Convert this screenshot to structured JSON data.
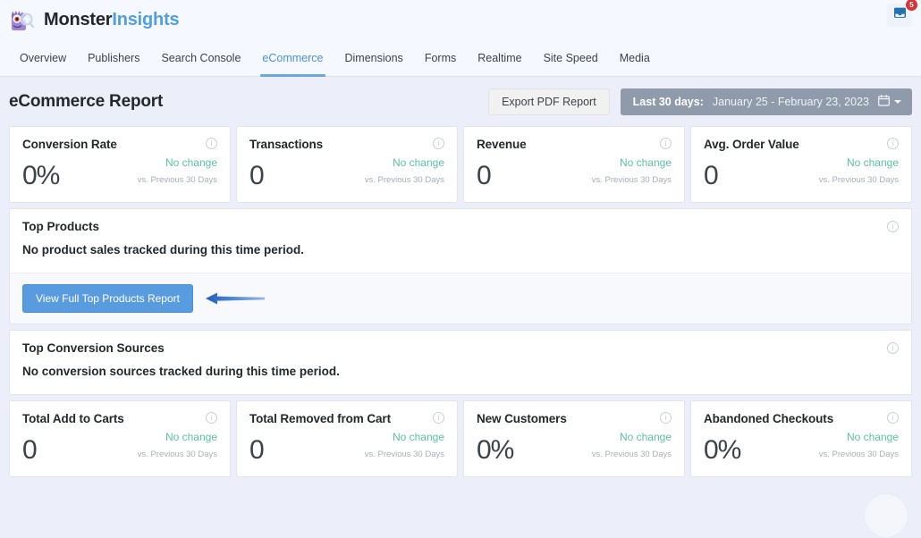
{
  "topbar": {
    "brand_first": "Monster",
    "brand_second": "Insights",
    "logo_icon": "monster-mascot-icon",
    "inbox_icon": "inbox-icon",
    "inbox_badge": "5"
  },
  "nav": {
    "tabs": [
      {
        "label": "Overview",
        "active": false
      },
      {
        "label": "Publishers",
        "active": false
      },
      {
        "label": "Search Console",
        "active": false
      },
      {
        "label": "eCommerce",
        "active": true
      },
      {
        "label": "Dimensions",
        "active": false
      },
      {
        "label": "Forms",
        "active": false
      },
      {
        "label": "Realtime",
        "active": false
      },
      {
        "label": "Site Speed",
        "active": false
      },
      {
        "label": "Media",
        "active": false
      }
    ]
  },
  "header": {
    "title": "eCommerce Report",
    "export_label": "Export PDF Report",
    "daterange_label": "Last 30 days:",
    "daterange_value": "January 25 - February 23, 2023",
    "calendar_icon": "calendar-icon",
    "caret_icon": "chevron-down-icon"
  },
  "stats_top": [
    {
      "title": "Conversion Rate",
      "value": "0%",
      "delta": "No change",
      "delta_sub": "vs. Previous 30 Days",
      "info_icon": "info-icon"
    },
    {
      "title": "Transactions",
      "value": "0",
      "delta": "No change",
      "delta_sub": "vs. Previous 30 Days",
      "info_icon": "info-icon"
    },
    {
      "title": "Revenue",
      "value": "0",
      "delta": "No change",
      "delta_sub": "vs. Previous 30 Days",
      "info_icon": "info-icon"
    },
    {
      "title": "Avg. Order Value",
      "value": "0",
      "delta": "No change",
      "delta_sub": "vs. Previous 30 Days",
      "info_icon": "info-icon"
    }
  ],
  "top_products": {
    "title": "Top Products",
    "info_icon": "info-icon",
    "empty_message": "No product sales tracked during this time period.",
    "button_label": "View Full Top Products Report",
    "annotation_icon": "left-arrow-annotation-icon"
  },
  "top_conversion_sources": {
    "title": "Top Conversion Sources",
    "info_icon": "info-icon",
    "empty_message": "No conversion sources tracked during this time period."
  },
  "stats_bottom": [
    {
      "title": "Total Add to Carts",
      "value": "0",
      "delta": "No change",
      "delta_sub": "vs. Previous 30 Days",
      "info_icon": "info-icon"
    },
    {
      "title": "Total Removed from Cart",
      "value": "0",
      "delta": "No change",
      "delta_sub": "vs. Previous 30 Days",
      "info_icon": "info-icon"
    },
    {
      "title": "New Customers",
      "value": "0%",
      "delta": "No change",
      "delta_sub": "vs. Previous 30 Days",
      "info_icon": "info-icon"
    },
    {
      "title": "Abandoned Checkouts",
      "value": "0%",
      "delta": "No change",
      "delta_sub": "vs. Previous 30 Days",
      "info_icon": "info-icon"
    }
  ],
  "colors": {
    "accent_blue": "#589bdf",
    "brand_blue": "#509fe2",
    "delta_green": "#5bc2a4",
    "badge_red": "#d63638",
    "daterange_grey": "#8f9bab",
    "page_bg": "#eceffa"
  }
}
